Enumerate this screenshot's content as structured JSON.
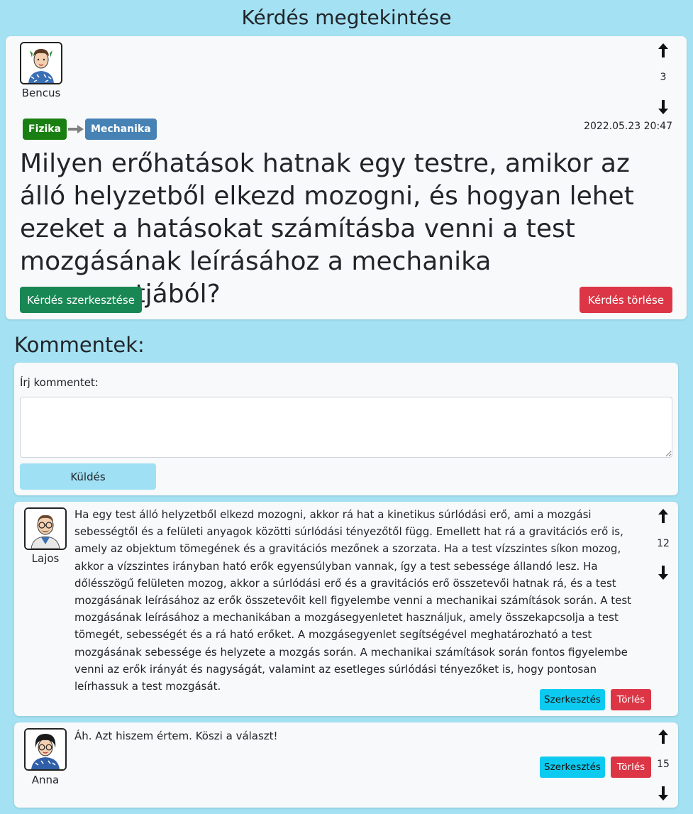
{
  "page": {
    "title": "Kérdés megtekintése"
  },
  "question": {
    "author": "Bencus",
    "votes": "3",
    "tags": [
      {
        "label": "Fizika",
        "color": "#1a7f12"
      },
      {
        "label": "Mechanika",
        "color": "#4682b4"
      }
    ],
    "date": "2022.05.23 20:47",
    "title": "Milyen erőhatások hatnak egy testre, amikor az álló helyzetből elkezd mozogni, és hogyan lehet ezeket a hatásokat számításba venni a test mozgásának leírásához a mechanika szempontjából?",
    "edit_label": "Kérdés szerkesztése",
    "delete_label": "Kérdés törlése"
  },
  "comments_section": {
    "heading": "Kommentek:",
    "form": {
      "label": "Írj kommentet:",
      "value": "",
      "submit_label": "Küldés"
    }
  },
  "comments": [
    {
      "author": "Lajos",
      "votes": "12",
      "text": "Ha egy test álló helyzetből elkezd mozogni, akkor rá hat a kinetikus súrlódási erő, ami a mozgási sebességtől és a felületi anyagok közötti súrlódási tényezőtől függ. Emellett hat rá a gravitációs erő is, amely az objektum tömegének és a gravitációs mezőnek a szorzata. Ha a test vízszintes síkon mozog, akkor a vízszintes irányban ható erők egyensúlyban vannak, így a test sebessége állandó lesz. Ha dőlésszögű felületen mozog, akkor a súrlódási erő és a gravitációs erő összetevői hatnak rá, és a test mozgásának leírásához az erők összetevőit kell figyelembe venni a mechanikai számítások során. A test mozgásának leírásához a mechanikában a mozgásegyenletet használjuk, amely összekapcsolja a test tömegét, sebességét és a rá ható erőket. A mozgásegyenlet segítségével meghatározható a test mozgásának sebessége és helyzete a mozgás során. A mechanikai számítások során fontos figyelembe venni az erők irányát és nagyságát, valamint az esetleges súrlódási tényezőket is, hogy pontosan leírhassuk a test mozgását.",
      "edit_label": "Szerkesztés",
      "delete_label": "Törlés"
    },
    {
      "author": "Anna",
      "votes": "15",
      "text": "Áh. Azt hiszem értem. Köszi a választ!",
      "edit_label": "Szerkesztés",
      "delete_label": "Törlés"
    }
  ],
  "colors": {
    "background": "#a3e1f3",
    "card": "#f8f9fa",
    "success": "#198754",
    "danger": "#dc3545",
    "info": "#0dcaf0",
    "light_info": "#9fe0f4"
  },
  "icons": {
    "upvote": "arrow-up-icon",
    "downvote": "arrow-down-icon"
  }
}
